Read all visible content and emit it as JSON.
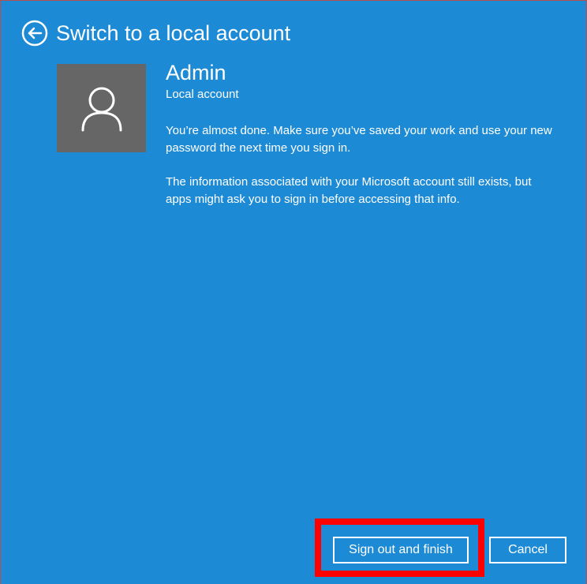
{
  "header": {
    "title": "Switch to a local account",
    "back_icon": "back-arrow-icon"
  },
  "account": {
    "avatar_icon": "user-icon",
    "name": "Admin",
    "type": "Local account"
  },
  "messages": {
    "line1": "You’re almost done. Make sure you’ve saved your work and use your new password the next time you sign in.",
    "line2": "The information associated with your Microsoft account still exists, but apps might ask you to sign in before accessing that info."
  },
  "buttons": {
    "sign_out_finish": "Sign out and finish",
    "cancel": "Cancel"
  },
  "colors": {
    "background": "#1d8ad6",
    "avatar_background": "#666666",
    "highlight": "#ff0000",
    "text": "#ffffff"
  }
}
